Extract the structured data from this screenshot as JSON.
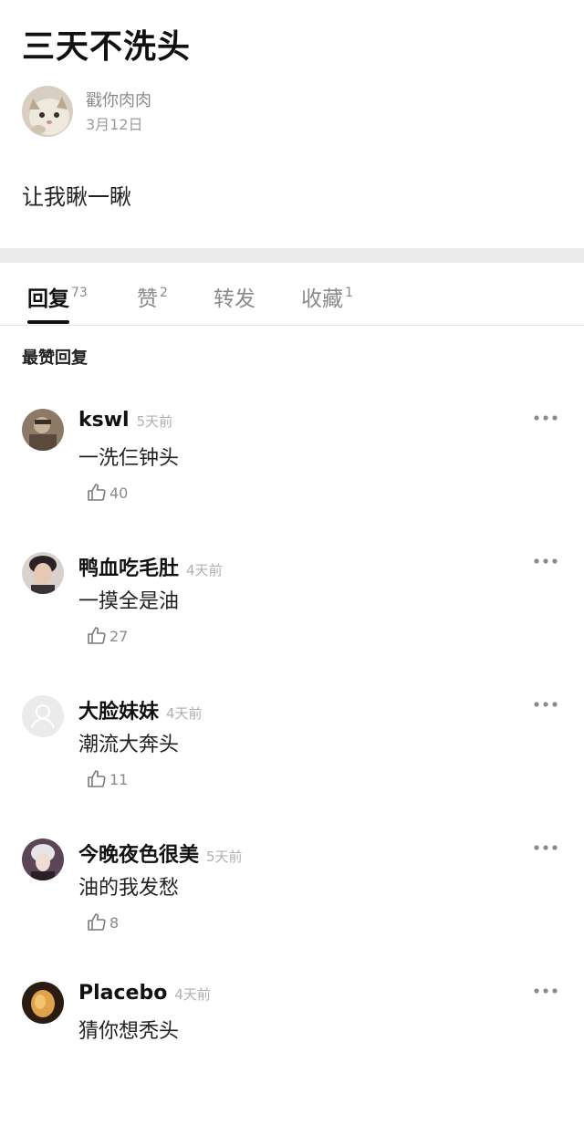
{
  "post": {
    "title": "三天不洗头",
    "author": "戳你肉肉",
    "date": "3月12日",
    "body": "让我瞅一瞅"
  },
  "tabs": [
    {
      "label": "回复",
      "count": "73",
      "active": true
    },
    {
      "label": "赞",
      "count": "2",
      "active": false
    },
    {
      "label": "转发",
      "count": "",
      "active": false
    },
    {
      "label": "收藏",
      "count": "1",
      "active": false
    }
  ],
  "section_heading": "最赞回复",
  "comments": [
    {
      "username": "kswl",
      "time": "5天前",
      "text": "一洗仨钟头",
      "likes": "40",
      "avatar_color": "#7a6a5a"
    },
    {
      "username": "鸭血吃毛肚",
      "time": "4天前",
      "text": "一摸全是油",
      "likes": "27",
      "avatar_color": "#3a3030"
    },
    {
      "username": "大脸妹妹",
      "time": "4天前",
      "text": "潮流大奔头",
      "likes": "11",
      "avatar_color": "#e4e4e4"
    },
    {
      "username": "今晚夜色很美",
      "time": "5天前",
      "text": "油的我发愁",
      "likes": "8",
      "avatar_color": "#4a3a48"
    },
    {
      "username": "Placebo",
      "time": "4天前",
      "text": "猜你想秃头",
      "likes": "",
      "avatar_color": "#c08a2a"
    }
  ],
  "icons": {
    "like": "thumbs-up-icon",
    "more": "more-horizontal-icon",
    "default_avatar": "user-placeholder-icon"
  },
  "colors": {
    "background": "#ffffff",
    "divider": "#ececec",
    "text_primary": "#111111",
    "text_secondary": "#8a8a8a"
  }
}
